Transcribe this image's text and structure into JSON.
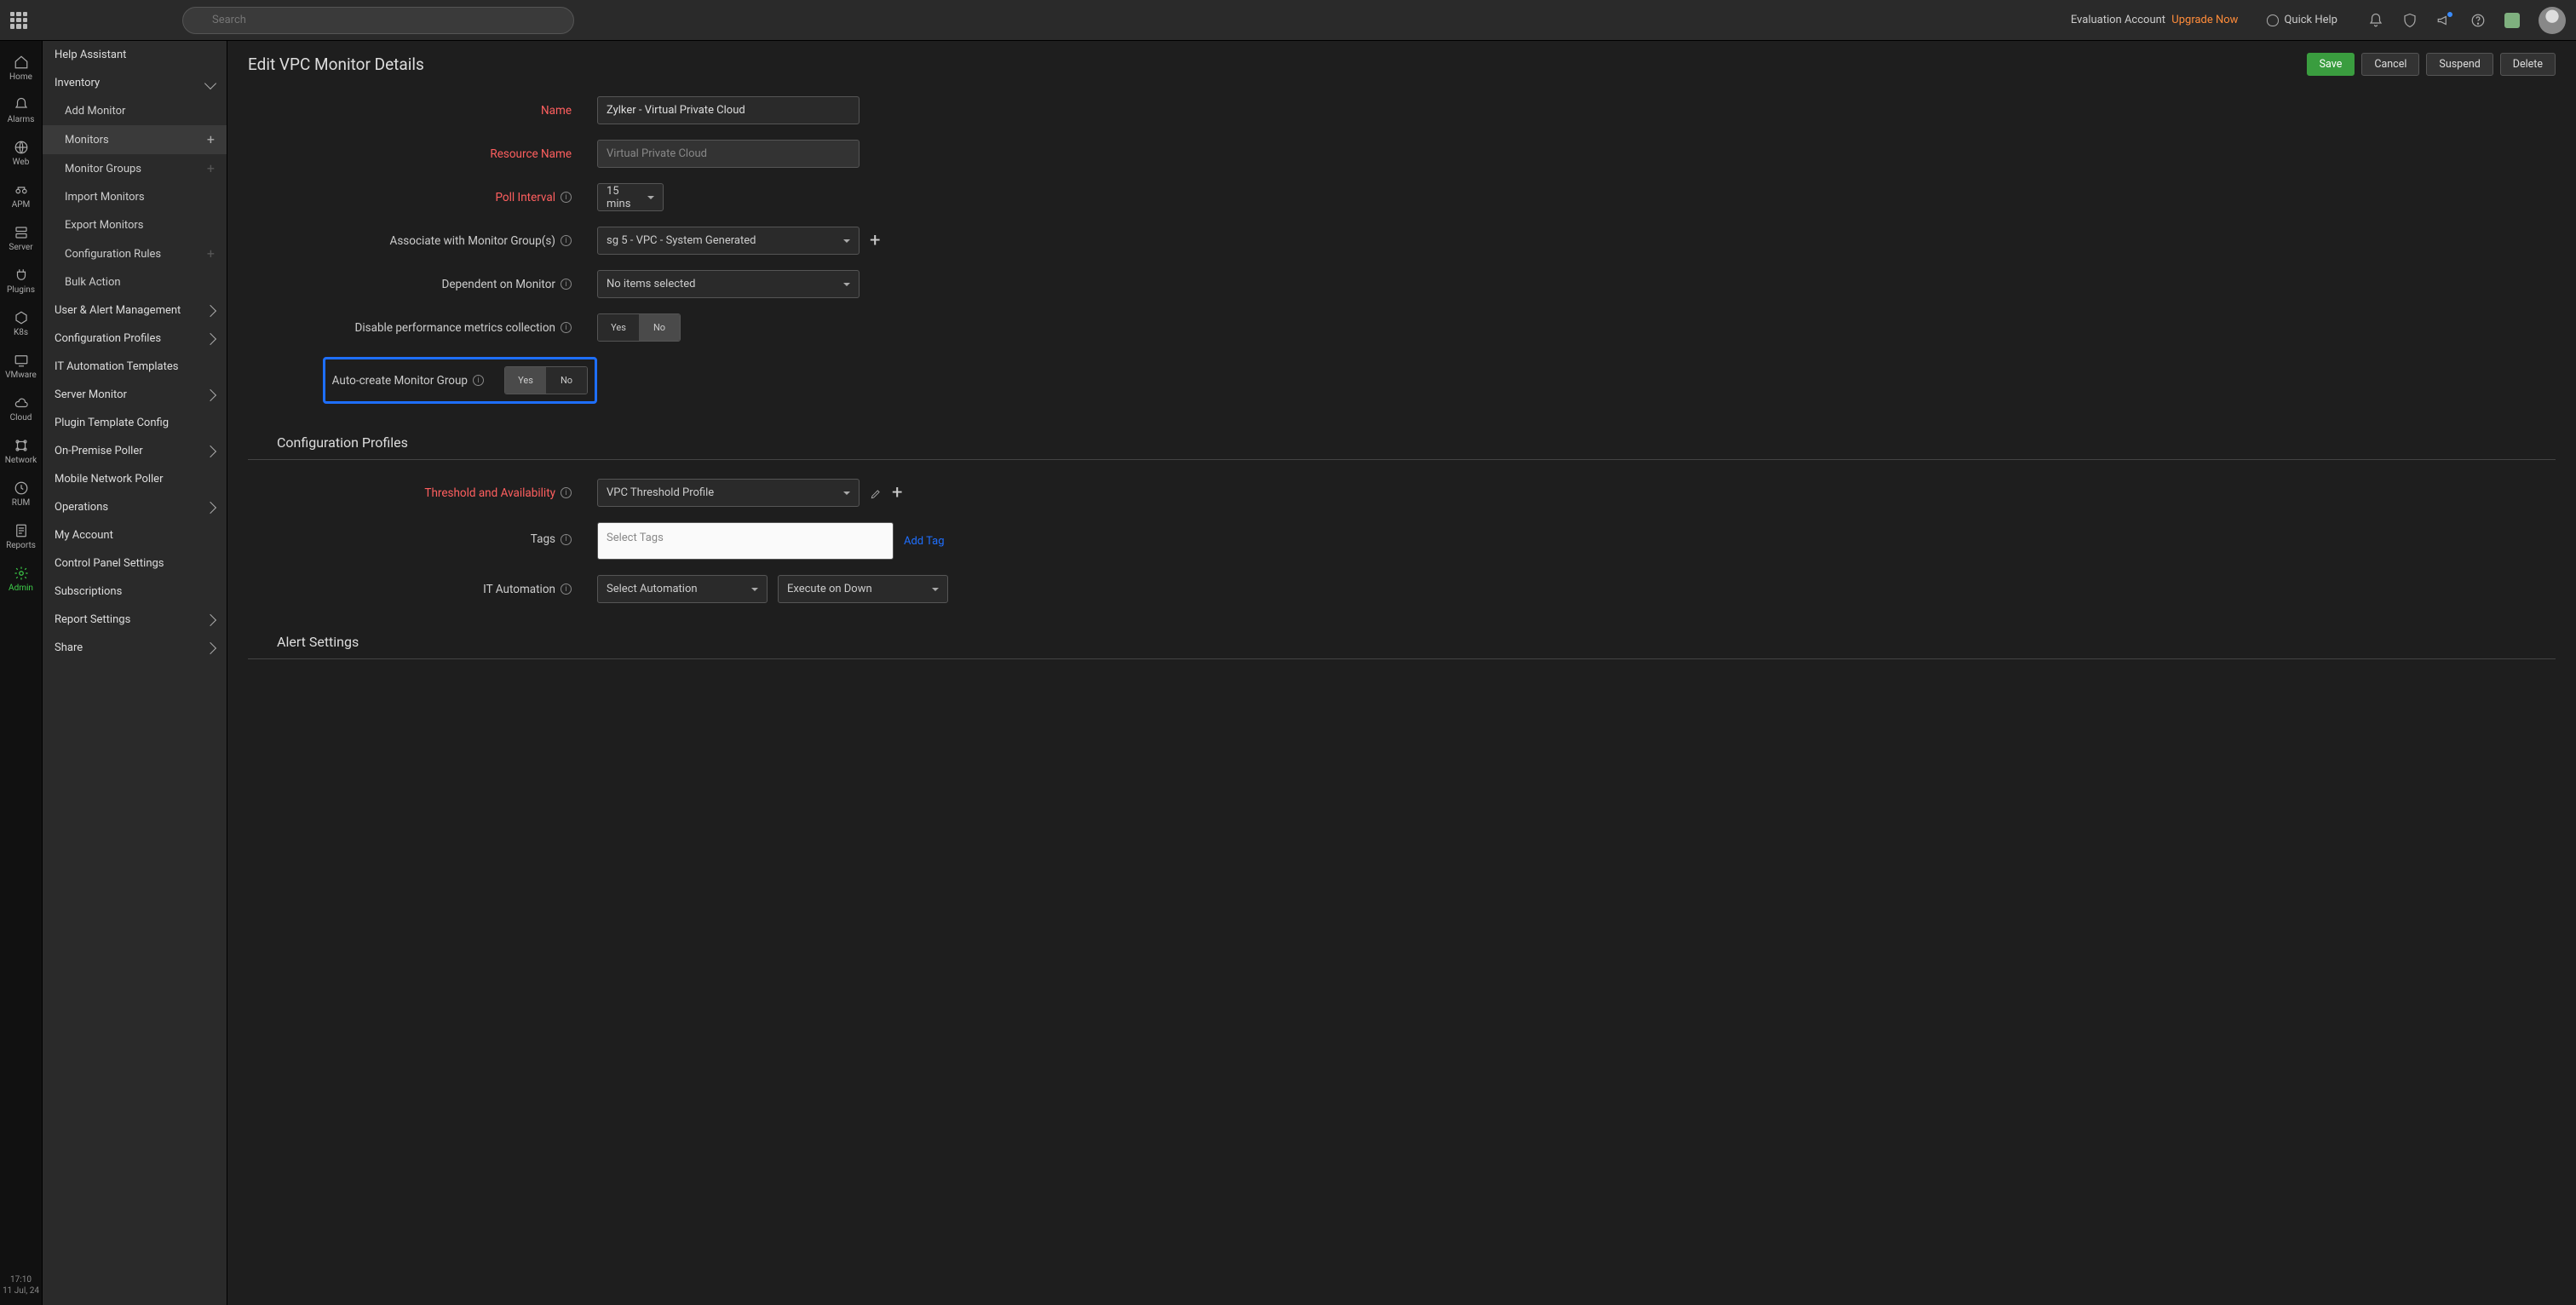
{
  "topbar": {
    "search_placeholder": "Search",
    "eval_label": "Evaluation Account",
    "upgrade_label": "Upgrade Now",
    "quick_help": "Quick Help"
  },
  "rail": {
    "items": [
      {
        "label": "Home"
      },
      {
        "label": "Alarms"
      },
      {
        "label": "Web"
      },
      {
        "label": "APM"
      },
      {
        "label": "Server"
      },
      {
        "label": "Plugins"
      },
      {
        "label": "K8s"
      },
      {
        "label": "VMware"
      },
      {
        "label": "Cloud"
      },
      {
        "label": "Network"
      },
      {
        "label": "RUM"
      },
      {
        "label": "Reports"
      },
      {
        "label": "Admin"
      }
    ],
    "time": "17:10",
    "date": "11 Jul, 24"
  },
  "side": {
    "items": [
      {
        "label": "Help Assistant",
        "kind": "plain"
      },
      {
        "label": "Inventory",
        "kind": "parent-open"
      },
      {
        "label": "Add Monitor",
        "kind": "child"
      },
      {
        "label": "Monitors",
        "kind": "child-plus",
        "active": true
      },
      {
        "label": "Monitor Groups",
        "kind": "child-plus-dim"
      },
      {
        "label": "Import Monitors",
        "kind": "child"
      },
      {
        "label": "Export Monitors",
        "kind": "child"
      },
      {
        "label": "Configuration Rules",
        "kind": "child-plus-dim"
      },
      {
        "label": "Bulk Action",
        "kind": "child"
      },
      {
        "label": "User & Alert Management",
        "kind": "parent"
      },
      {
        "label": "Configuration Profiles",
        "kind": "parent"
      },
      {
        "label": "IT Automation Templates",
        "kind": "plain"
      },
      {
        "label": "Server Monitor",
        "kind": "parent"
      },
      {
        "label": "Plugin Template Config",
        "kind": "plain"
      },
      {
        "label": "On-Premise Poller",
        "kind": "parent"
      },
      {
        "label": "Mobile Network Poller",
        "kind": "plain"
      },
      {
        "label": "Operations",
        "kind": "parent"
      },
      {
        "label": "My Account",
        "kind": "plain"
      },
      {
        "label": "Control Panel Settings",
        "kind": "plain"
      },
      {
        "label": "Subscriptions",
        "kind": "plain"
      },
      {
        "label": "Report Settings",
        "kind": "parent"
      },
      {
        "label": "Share",
        "kind": "parent"
      }
    ]
  },
  "page": {
    "title": "Edit VPC Monitor Details",
    "buttons": {
      "save": "Save",
      "cancel": "Cancel",
      "suspend": "Suspend",
      "delete": "Delete"
    },
    "section_profiles": "Configuration Profiles",
    "section_alert": "Alert Settings"
  },
  "form": {
    "name": {
      "label": "Name",
      "value": "Zylker - Virtual Private Cloud"
    },
    "resource": {
      "label": "Resource Name",
      "value": "Virtual Private Cloud"
    },
    "poll": {
      "label": "Poll Interval",
      "value": "15 mins"
    },
    "assoc": {
      "label": "Associate with Monitor Group(s)",
      "value": "sg 5 - VPC - System Generated"
    },
    "dep": {
      "label": "Dependent on Monitor",
      "value": "No items selected"
    },
    "disable": {
      "label": "Disable performance metrics collection",
      "yes": "Yes",
      "no": "No"
    },
    "auto": {
      "label": "Auto-create Monitor Group",
      "yes": "Yes",
      "no": "No"
    },
    "thresh": {
      "label": "Threshold and Availability",
      "value": "VPC Threshold Profile"
    },
    "tags": {
      "label": "Tags",
      "placeholder": "Select Tags",
      "add": "Add Tag"
    },
    "itauto": {
      "label": "IT Automation",
      "sel1": "Select Automation",
      "sel2": "Execute on Down"
    }
  }
}
